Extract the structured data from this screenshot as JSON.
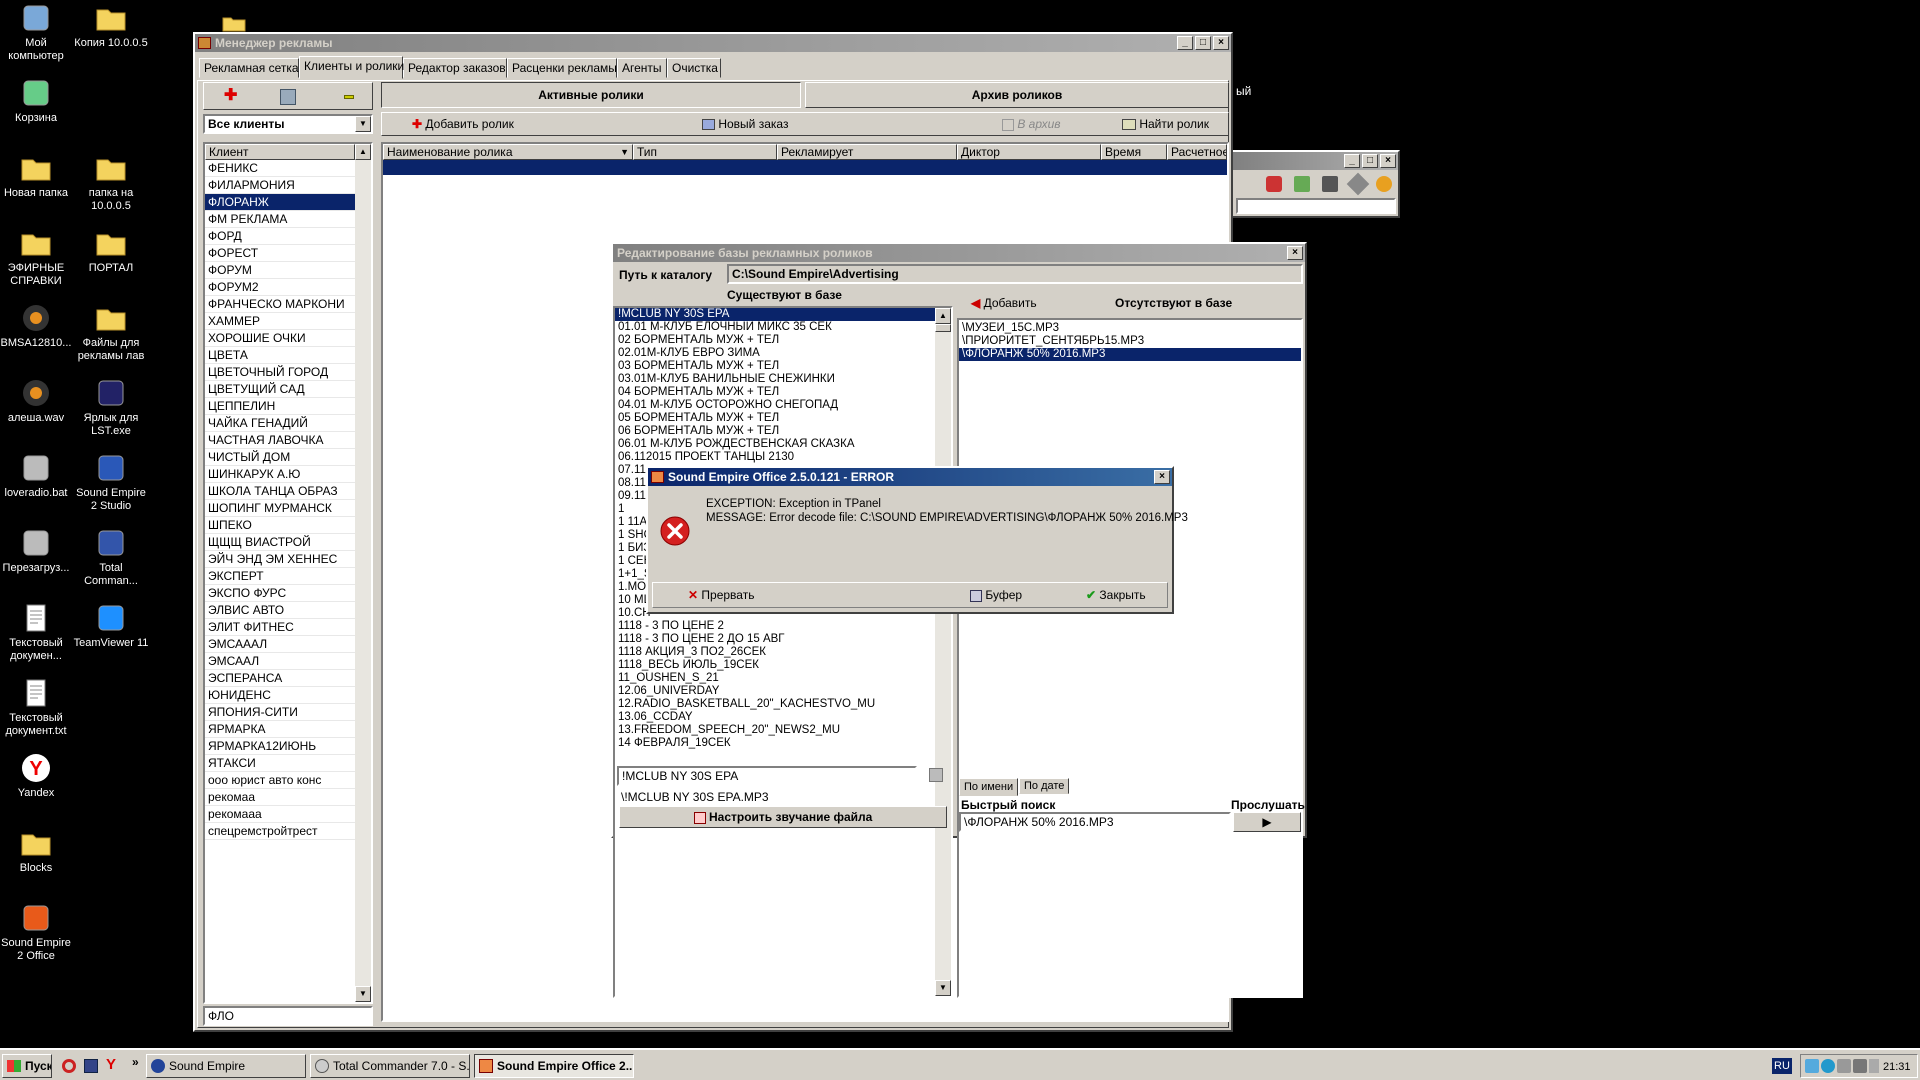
{
  "desktop": {
    "icons": [
      {
        "label": "Мой компьютер",
        "icon": "computer-icon"
      },
      {
        "label": "Копия 10.0.0.5",
        "icon": "folder-icon"
      },
      {
        "label": "Корзина",
        "icon": "recycle-bin-icon"
      },
      {
        "label": "Новая папка",
        "icon": "folder-icon"
      },
      {
        "label": "папка на 10.0.0.5",
        "icon": "network-folder-icon"
      },
      {
        "label": "ЭФИРНЫЕ СПРАВКИ",
        "icon": "folder-icon"
      },
      {
        "label": "ПОРТАЛ",
        "icon": "folder-icon"
      },
      {
        "label": "BMSA12810...",
        "icon": "audio-file-icon"
      },
      {
        "label": "Файлы для рекламы лав",
        "icon": "folder-icon"
      },
      {
        "label": "алеша.wav",
        "icon": "audio-file-icon"
      },
      {
        "label": "Ярлык для LST.exe",
        "icon": "shortcut-icon"
      },
      {
        "label": "loveradio.bat",
        "icon": "batch-file-icon"
      },
      {
        "label": "Sound Empire 2 Studio",
        "icon": "sound-empire-studio-icon"
      },
      {
        "label": "Перезагруз...",
        "icon": "batch-file-icon"
      },
      {
        "label": "Total Comman...",
        "icon": "floppy-icon"
      },
      {
        "label": "Текстовый докумен...",
        "icon": "text-file-icon"
      },
      {
        "label": "TeamViewer 11",
        "icon": "teamviewer-icon"
      },
      {
        "label": "Текстовый документ.txt",
        "icon": "text-file-icon"
      },
      {
        "label": "Yandex",
        "icon": "yandex-icon"
      },
      {
        "label": "Blocks",
        "icon": "folder-icon"
      },
      {
        "label": "Sound Empire 2 Office",
        "icon": "sound-empire-office-icon"
      }
    ],
    "stray_text": "ый"
  },
  "manager": {
    "title": "Менеджер рекламы",
    "tabs": [
      "Рекламная сетка",
      "Клиенты и ролики",
      "Редактор заказов",
      "Расценки рекламы",
      "Агенты",
      "Очистка"
    ],
    "client_filter": "Все клиенты",
    "client_header": "Клиент",
    "clients": [
      "ФЕНИКС",
      "ФИЛАРМОНИЯ",
      "ФЛОРАНЖ",
      "ФМ РЕКЛАМА",
      "ФОРД",
      "ФОРЕСТ",
      "ФОРУМ",
      "ФОРУМ2",
      "ФРАНЧЕСКО МАРКОНИ",
      "ХАММЕР",
      "ХОРОШИЕ ОЧКИ",
      "ЦВЕТА",
      "ЦВЕТОЧНЫЙ ГОРОД",
      "ЦВЕТУЩИЙ САД",
      "ЦЕППЕЛИН",
      "ЧАЙКА ГЕНАДИЙ",
      "ЧАСТНАЯ ЛАВОЧКА",
      "ЧИСТЫЙ ДОМ",
      "ШИНКАРУК А.Ю",
      "ШКОЛА ТАНЦА ОБРАЗ",
      "ШОПИНГ МУРМАНСК",
      "ШПЕКО",
      "ЩЩЩ ВИАСТРОЙ",
      "ЭЙЧ ЭНД ЭМ ХЕННЕС",
      "ЭКСПЕРТ",
      "ЭКСПО ФУРС",
      "ЭЛВИС АВТО",
      "ЭЛИТ ФИТНЕС",
      "ЭМСАААЛ",
      "ЭМСААЛ",
      "ЭСПЕРАНСА",
      "ЮНИДЕНС",
      "ЯПОНИЯ-СИТИ",
      "ЯРМАРКА",
      "ЯРМАРКА12ИЮНЬ",
      "ЯТАКСИ",
      "ооо юрист авто конс",
      "рекомаа",
      "рекомааа",
      "спецремстройтрест"
    ],
    "selected_client": "ФЛОРАНЖ",
    "client_search": "ФЛО",
    "section_active": "Активные ролики",
    "section_archive": "Архив роликов",
    "add_clip": "Добавить ролик",
    "new_order": "Новый заказ",
    "to_archive": "В архив",
    "find_clip": "Найти ролик",
    "columns": [
      "Наименование ролика",
      "Тип",
      "Рекламирует",
      "Диктор",
      "Время",
      "Расчетное"
    ]
  },
  "dbeditor": {
    "title": "Редактирование базы рекламных роликов",
    "path_label": "Путь к каталогу",
    "path_value": "C:\\Sound Empire\\Advertising",
    "exists_label": "Существуют в базе",
    "missing_label": "Отсутствуют в базе",
    "add_label": "Добавить",
    "exists_items": [
      "!MCLUB NY 30S EPA",
      "01.01 М-КЛУБ ЕЛОЧНЫЙ МИКС 35 СЕК",
      "02 БОРМЕНТАЛЬ МУЖ + ТЕЛ",
      "02.01М-КЛУБ ЕВРО ЗИМА",
      "03 БОРМЕНТАЛЬ МУЖ + ТЕЛ",
      "03.01М-КЛУБ ВАНИЛЬНЫЕ СНЕЖИНКИ",
      "04 БОРМЕНТАЛЬ МУЖ + ТЕЛ",
      "04.01 М-КЛУБ ОСТОРОЖНО СНЕГОПАД",
      "05 БОРМЕНТАЛЬ МУЖ + ТЕЛ",
      "06 БОРМЕНТАЛЬ МУЖ + ТЕЛ",
      "06.01 М-КЛУБ РОЖДЕСТВЕНСКАЯ СКАЗКА",
      "06.112015  ПРОЕКТ ТАНЦЫ 2130",
      "07.11",
      "08.11",
      "09.11",
      "1",
      "1 11А",
      "1 SHO",
      "1 БИЗ",
      "1 СЕН",
      "1+1_S",
      "1.МО",
      "10 МЦ",
      "10.СН",
      "1118 - 3 ПО ЦЕНЕ 2",
      "1118 - 3 ПО ЦЕНЕ 2 ДО 15 АВГ",
      "1118 АКЦИЯ_3 ПО2_26СЕК",
      "1118_ВЕСЬ ИЮЛЬ_19СЕК",
      "11_OUSHEN_S_21",
      "12.06_UNIVERDAY",
      "12.RADIO_BASKETBALL_20\"_KACHESTVO_MU",
      "13.06_CCDAY",
      "13.FREEDOM_SPEECH_20\"_NEWS2_MU",
      "14 ФЕВРАЛЯ_19СЕК"
    ],
    "missing_items": [
      "\\МУЗЕЙ_15С.MP3",
      "\\ПРИОРИТЕТ_СЕНТЯБРЬ15.MP3",
      "\\ФЛОРАНЖ 50% 2016.MP3"
    ],
    "selected_exists": "!MCLUB NY 30S EPA",
    "selected_missing": "\\ФЛОРАНЖ 50% 2016.MP3",
    "name_field": "!MCLUB NY 30S EPA",
    "file_name": "\\!MCLUB NY 30S EPA.MP3",
    "adjust_sound": "Настроить звучание файла",
    "sort_tabs": [
      "По имени",
      "По дате"
    ],
    "quick_search_label": "Быстрый поиск",
    "listen_label": "Прослушать",
    "quick_search_value": "\\ФЛОРАНЖ 50% 2016.MP3"
  },
  "error": {
    "title": "Sound Empire Office 2.5.0.121 - ERROR",
    "exception": "EXCEPTION: Exception in TPanel",
    "message": "MESSAGE: Error decode file: C:\\SOUND EMPIRE\\ADVERTISING\\ФЛОРАНЖ 50% 2016.MP3",
    "abort": "Прервать",
    "buffer": "Буфер",
    "close": "Закрыть"
  },
  "taskbar": {
    "start": "Пуск",
    "tasks": [
      "Sound Empire",
      "Total Commander 7.0 - S...",
      "Sound Empire Office 2..."
    ],
    "lang": "RU",
    "clock": "21:31"
  },
  "colors": {
    "selection": "#0a246a",
    "face": "#d4d0c8",
    "error_red": "#d42020"
  }
}
